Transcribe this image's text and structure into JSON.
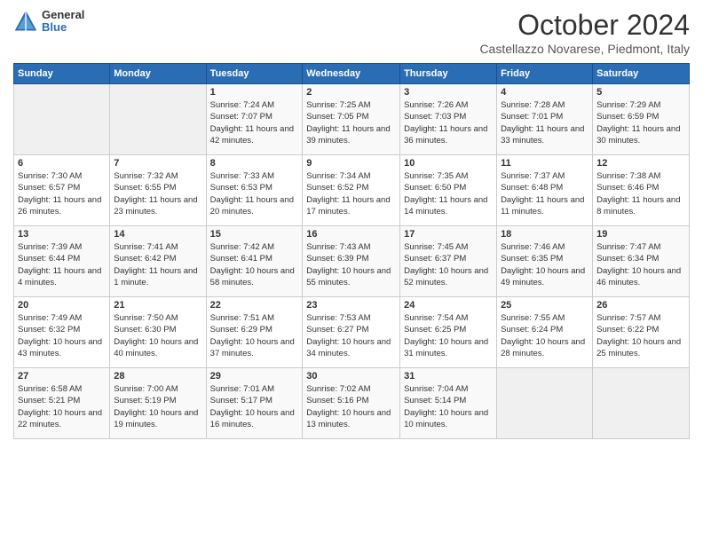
{
  "logo": {
    "general": "General",
    "blue": "Blue"
  },
  "header": {
    "month": "October 2024",
    "location": "Castellazzo Novarese, Piedmont, Italy"
  },
  "weekdays": [
    "Sunday",
    "Monday",
    "Tuesday",
    "Wednesday",
    "Thursday",
    "Friday",
    "Saturday"
  ],
  "weeks": [
    [
      {
        "day": null
      },
      {
        "day": null
      },
      {
        "day": "1",
        "sunrise": "7:24 AM",
        "sunset": "7:07 PM",
        "daylight": "11 hours and 42 minutes."
      },
      {
        "day": "2",
        "sunrise": "7:25 AM",
        "sunset": "7:05 PM",
        "daylight": "11 hours and 39 minutes."
      },
      {
        "day": "3",
        "sunrise": "7:26 AM",
        "sunset": "7:03 PM",
        "daylight": "11 hours and 36 minutes."
      },
      {
        "day": "4",
        "sunrise": "7:28 AM",
        "sunset": "7:01 PM",
        "daylight": "11 hours and 33 minutes."
      },
      {
        "day": "5",
        "sunrise": "7:29 AM",
        "sunset": "6:59 PM",
        "daylight": "11 hours and 30 minutes."
      }
    ],
    [
      {
        "day": "6",
        "sunrise": "7:30 AM",
        "sunset": "6:57 PM",
        "daylight": "11 hours and 26 minutes."
      },
      {
        "day": "7",
        "sunrise": "7:32 AM",
        "sunset": "6:55 PM",
        "daylight": "11 hours and 23 minutes."
      },
      {
        "day": "8",
        "sunrise": "7:33 AM",
        "sunset": "6:53 PM",
        "daylight": "11 hours and 20 minutes."
      },
      {
        "day": "9",
        "sunrise": "7:34 AM",
        "sunset": "6:52 PM",
        "daylight": "11 hours and 17 minutes."
      },
      {
        "day": "10",
        "sunrise": "7:35 AM",
        "sunset": "6:50 PM",
        "daylight": "11 hours and 14 minutes."
      },
      {
        "day": "11",
        "sunrise": "7:37 AM",
        "sunset": "6:48 PM",
        "daylight": "11 hours and 11 minutes."
      },
      {
        "day": "12",
        "sunrise": "7:38 AM",
        "sunset": "6:46 PM",
        "daylight": "11 hours and 8 minutes."
      }
    ],
    [
      {
        "day": "13",
        "sunrise": "7:39 AM",
        "sunset": "6:44 PM",
        "daylight": "11 hours and 4 minutes."
      },
      {
        "day": "14",
        "sunrise": "7:41 AM",
        "sunset": "6:42 PM",
        "daylight": "11 hours and 1 minute."
      },
      {
        "day": "15",
        "sunrise": "7:42 AM",
        "sunset": "6:41 PM",
        "daylight": "10 hours and 58 minutes."
      },
      {
        "day": "16",
        "sunrise": "7:43 AM",
        "sunset": "6:39 PM",
        "daylight": "10 hours and 55 minutes."
      },
      {
        "day": "17",
        "sunrise": "7:45 AM",
        "sunset": "6:37 PM",
        "daylight": "10 hours and 52 minutes."
      },
      {
        "day": "18",
        "sunrise": "7:46 AM",
        "sunset": "6:35 PM",
        "daylight": "10 hours and 49 minutes."
      },
      {
        "day": "19",
        "sunrise": "7:47 AM",
        "sunset": "6:34 PM",
        "daylight": "10 hours and 46 minutes."
      }
    ],
    [
      {
        "day": "20",
        "sunrise": "7:49 AM",
        "sunset": "6:32 PM",
        "daylight": "10 hours and 43 minutes."
      },
      {
        "day": "21",
        "sunrise": "7:50 AM",
        "sunset": "6:30 PM",
        "daylight": "10 hours and 40 minutes."
      },
      {
        "day": "22",
        "sunrise": "7:51 AM",
        "sunset": "6:29 PM",
        "daylight": "10 hours and 37 minutes."
      },
      {
        "day": "23",
        "sunrise": "7:53 AM",
        "sunset": "6:27 PM",
        "daylight": "10 hours and 34 minutes."
      },
      {
        "day": "24",
        "sunrise": "7:54 AM",
        "sunset": "6:25 PM",
        "daylight": "10 hours and 31 minutes."
      },
      {
        "day": "25",
        "sunrise": "7:55 AM",
        "sunset": "6:24 PM",
        "daylight": "10 hours and 28 minutes."
      },
      {
        "day": "26",
        "sunrise": "7:57 AM",
        "sunset": "6:22 PM",
        "daylight": "10 hours and 25 minutes."
      }
    ],
    [
      {
        "day": "27",
        "sunrise": "6:58 AM",
        "sunset": "5:21 PM",
        "daylight": "10 hours and 22 minutes."
      },
      {
        "day": "28",
        "sunrise": "7:00 AM",
        "sunset": "5:19 PM",
        "daylight": "10 hours and 19 minutes."
      },
      {
        "day": "29",
        "sunrise": "7:01 AM",
        "sunset": "5:17 PM",
        "daylight": "10 hours and 16 minutes."
      },
      {
        "day": "30",
        "sunrise": "7:02 AM",
        "sunset": "5:16 PM",
        "daylight": "10 hours and 13 minutes."
      },
      {
        "day": "31",
        "sunrise": "7:04 AM",
        "sunset": "5:14 PM",
        "daylight": "10 hours and 10 minutes."
      },
      {
        "day": null
      },
      {
        "day": null
      }
    ]
  ],
  "labels": {
    "sunrise": "Sunrise:",
    "sunset": "Sunset:",
    "daylight": "Daylight:"
  }
}
